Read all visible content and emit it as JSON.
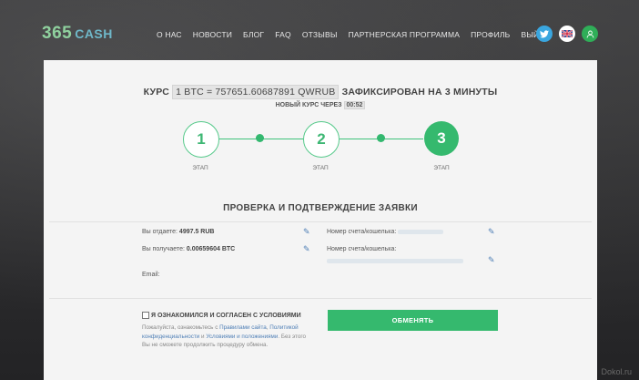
{
  "header": {
    "logo_number": "365",
    "logo_text": "CASH",
    "nav": [
      "О НАС",
      "НОВОСТИ",
      "БЛОГ",
      "FAQ",
      "ОТЗЫВЫ",
      "ПАРТНЕРСКАЯ ПРОГРАММА",
      "ПРОФИЛЬ",
      "ВЫЙТИ"
    ],
    "icons": [
      "twitter-icon",
      "uk-flag-icon",
      "user-icon"
    ]
  },
  "rate": {
    "prefix": "КУРС",
    "value": "1 BTC = 757651.60687891 QWRUB",
    "suffix": "ЗАФИКСИРОВАН НА 3 МИНУТЫ",
    "new_rate_label": "НОВЫЙ КУРС ЧЕРЕЗ",
    "timer": "00:52"
  },
  "steps": [
    {
      "number": "1",
      "label": "ЭТАП"
    },
    {
      "number": "2",
      "label": "ЭТАП"
    },
    {
      "number": "3",
      "label": "ЭТАП"
    }
  ],
  "section_title": "ПРОВЕРКА И ПОДТВЕРЖДЕНИЕ ЗАЯВКИ",
  "fields": {
    "give_label": "Вы отдаете:",
    "give_value": "4997.5 RUB",
    "receive_label": "Вы получаете:",
    "receive_value": "0.00659604 BTC",
    "email_label": "Email:",
    "account1_label": "Номер счета/кошелька:",
    "account2_label": "Номер счета/кошелька:"
  },
  "agreement": {
    "label": "Я ОЗНАКОМИЛСЯ И СОГЛАСЕН С УСЛОВИЯМИ",
    "note_1": "Пожалуйста, ознакомьтесь с ",
    "link_1": "Правилами сайта",
    "note_2": ", ",
    "link_2": "Политикой конфиденциальности",
    "note_3": " и ",
    "link_3": "Условиями и положениями",
    "note_4": ". Без этого Вы не сможете продолжить процедуру обмена."
  },
  "submit_label": "ОБМЕНЯТЬ",
  "watermark": "Dokol.ru",
  "colors": {
    "accent": "#35b96e",
    "link": "#4f7fb6"
  }
}
